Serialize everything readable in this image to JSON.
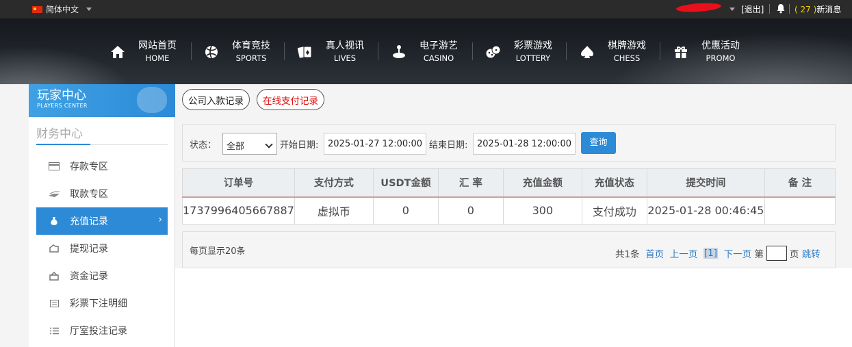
{
  "topbar": {
    "language": "简体中文",
    "logout": "[退出]",
    "message_count": "( 27 )",
    "message_label": "新消息"
  },
  "nav": [
    {
      "zh": "网站首页",
      "en": "HOME",
      "icon": "home-icon"
    },
    {
      "zh": "体育竞技",
      "en": "SPORTS",
      "icon": "ball-icon"
    },
    {
      "zh": "真人视讯",
      "en": "LIVES",
      "icon": "cards-icon"
    },
    {
      "zh": "电子游艺",
      "en": "CASINO",
      "icon": "joystick-icon"
    },
    {
      "zh": "彩票游戏",
      "en": "LOTTERY",
      "icon": "dice-icon"
    },
    {
      "zh": "棋牌游戏",
      "en": "CHESS",
      "icon": "spade-icon"
    },
    {
      "zh": "优惠活动",
      "en": "PROMO",
      "icon": "gift-icon"
    }
  ],
  "sidebar": {
    "title": "玩家中心",
    "subtitle": "PLAYERS CENTER",
    "section": "财务中心",
    "items": [
      {
        "label": "存款专区",
        "icon": "card-icon"
      },
      {
        "label": "取款专区",
        "icon": "cash-icon"
      },
      {
        "label": "充值记录",
        "icon": "moneybag-icon",
        "active": true,
        "arrow": "›"
      },
      {
        "label": "提现记录",
        "icon": "wallet-icon"
      },
      {
        "label": "资金记录",
        "icon": "fund-icon"
      },
      {
        "label": "彩票下注明细",
        "icon": "list-icon"
      },
      {
        "label": "厅室投注记录",
        "icon": "records-icon"
      }
    ]
  },
  "tabs": [
    "公司入款记录",
    "在线支付记录"
  ],
  "filter": {
    "status_label": "状态：",
    "status_value": "全部",
    "start_label": "开始日期:",
    "start_value": "2025-01-27 12:00:00",
    "end_label": "结束日期:",
    "end_value": "2025-01-28 12:00:00",
    "query": "查询"
  },
  "table": {
    "headers": [
      "订单号",
      "支付方式",
      "USDT金额",
      "汇 率",
      "充值金额",
      "充值状态",
      "提交时间",
      "备 注"
    ],
    "rows": [
      [
        "1737996405667887",
        "虚拟币",
        "0",
        "0",
        "300",
        "支付成功",
        "2025-01-28 00:46:45",
        ""
      ]
    ]
  },
  "pager": {
    "per_page": "每页显示20条",
    "total": "共1条",
    "first": "首页",
    "prev": "上一页",
    "current": "[1]",
    "next": "下一页",
    "page_prefix": "第",
    "page_suffix": "页",
    "jump": "跳转"
  }
}
